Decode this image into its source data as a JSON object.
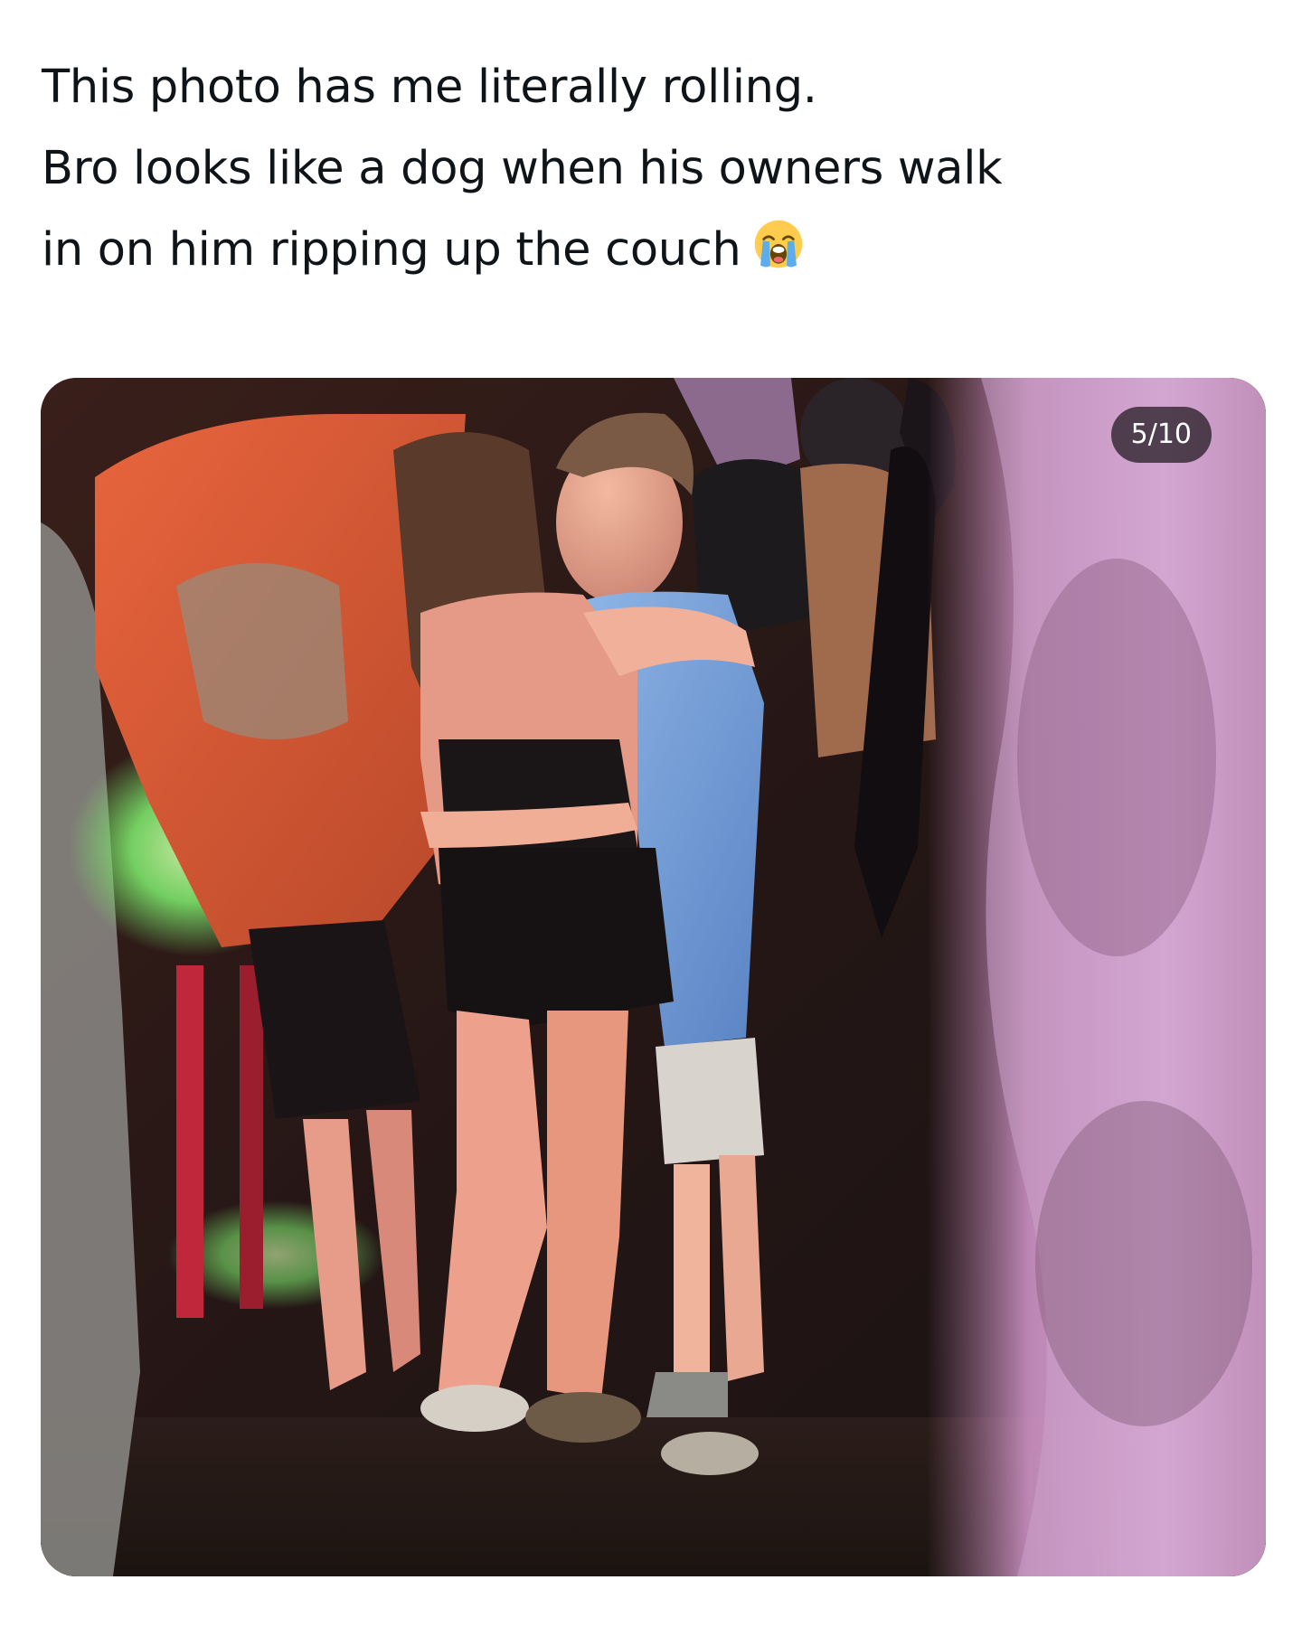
{
  "post": {
    "text_lines": [
      "This photo has me literally rolling.",
      "Bro looks like a dog when his owners walk",
      "in on him ripping up the couch"
    ],
    "emoji": "loudly-crying-face-icon"
  },
  "media": {
    "counter": "5/10"
  }
}
